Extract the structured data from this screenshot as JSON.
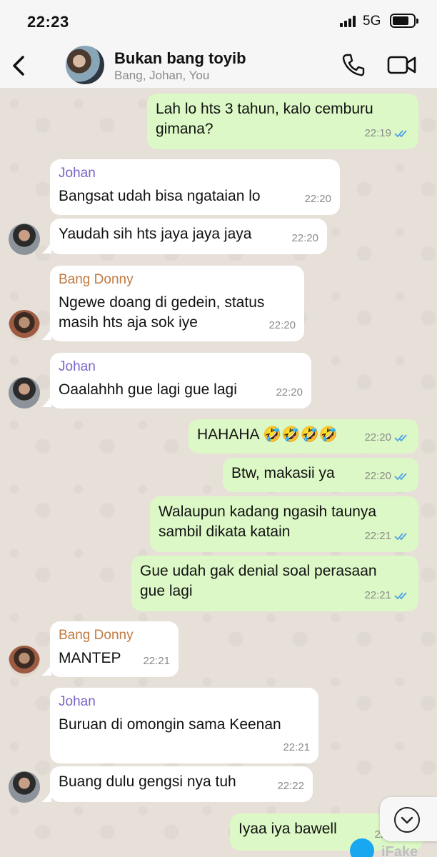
{
  "status_bar": {
    "time": "22:23",
    "network": "5G"
  },
  "header": {
    "title": "Bukan bang toyib",
    "subtitle": "Bang, Johan, You"
  },
  "colors": {
    "outgoing": "#dcf8c6",
    "incoming": "#ffffff",
    "johan_name": "#7b64c8",
    "donny_name": "#c0793f",
    "read_ticks": "#4fa3e6"
  },
  "messages": [
    {
      "direction": "out",
      "text": "Lah lo hts 3 tahun, kalo cemburu\ngimana?",
      "time": "22:19",
      "read": true
    },
    {
      "direction": "in",
      "sender": "Johan",
      "text": "Bangsat udah bisa ngataian lo",
      "time": "22:20"
    },
    {
      "direction": "in",
      "text": "Yaudah sih hts jaya jaya jaya",
      "time": "22:20"
    },
    {
      "direction": "in",
      "sender": "Bang Donny",
      "text": "Ngewe doang di gedein, status\nmasih hts aja sok iye",
      "time": "22:20"
    },
    {
      "direction": "in",
      "sender": "Johan",
      "text": "Oaalahhh gue lagi gue lagi",
      "time": "22:20"
    },
    {
      "direction": "out",
      "text": "HAHAHA 🤣🤣🤣🤣",
      "time": "22:20",
      "read": true
    },
    {
      "direction": "out",
      "text": "Btw, makasii ya",
      "time": "22:20",
      "read": true
    },
    {
      "direction": "out",
      "text": "Walaupun kadang ngasih taunya\nsambil dikata katain",
      "time": "22:21",
      "read": true
    },
    {
      "direction": "out",
      "text": "Gue udah gak denial soal perasaan\ngue lagi",
      "time": "22:21",
      "read": true
    },
    {
      "direction": "in",
      "sender": "Bang Donny",
      "text": "MANTEP",
      "time": "22:21"
    },
    {
      "direction": "in",
      "sender": "Johan",
      "text": "Buruan di omongin sama Keenan",
      "time": "22:21"
    },
    {
      "direction": "in",
      "text": "Buang dulu gengsi nya tuh",
      "time": "22:22"
    },
    {
      "direction": "out",
      "text": "Iyaa iya bawell",
      "time": "22:22"
    }
  ],
  "watermark": "iFake"
}
